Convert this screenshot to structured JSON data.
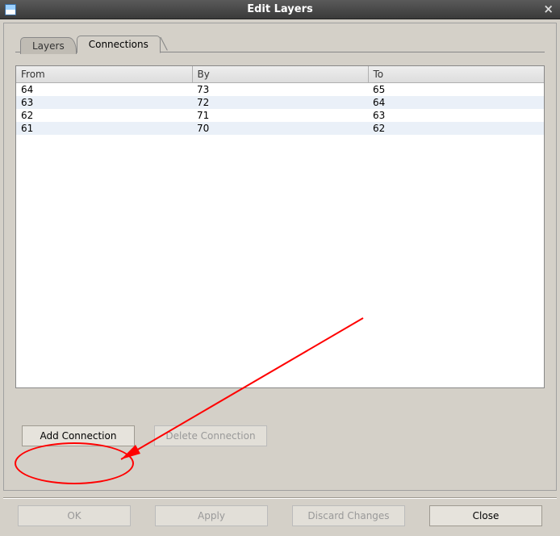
{
  "titlebar": {
    "title": "Edit Layers",
    "close_glyph": "×"
  },
  "tabs": {
    "layers_label": "Layers",
    "connections_label": "Connections"
  },
  "table": {
    "headers": {
      "from": "From",
      "by": "By",
      "to": "To"
    },
    "rows": [
      {
        "from": "64",
        "by": "73",
        "to": "65"
      },
      {
        "from": "63",
        "by": "72",
        "to": "64"
      },
      {
        "from": "62",
        "by": "71",
        "to": "63"
      },
      {
        "from": "61",
        "by": "70",
        "to": "62"
      }
    ]
  },
  "buttons": {
    "add_connection": "Add Connection",
    "delete_connection": "Delete Connection",
    "ok": "OK",
    "apply": "Apply",
    "discard": "Discard Changes",
    "close": "Close"
  },
  "annotation": {
    "color": "#ff0000"
  }
}
